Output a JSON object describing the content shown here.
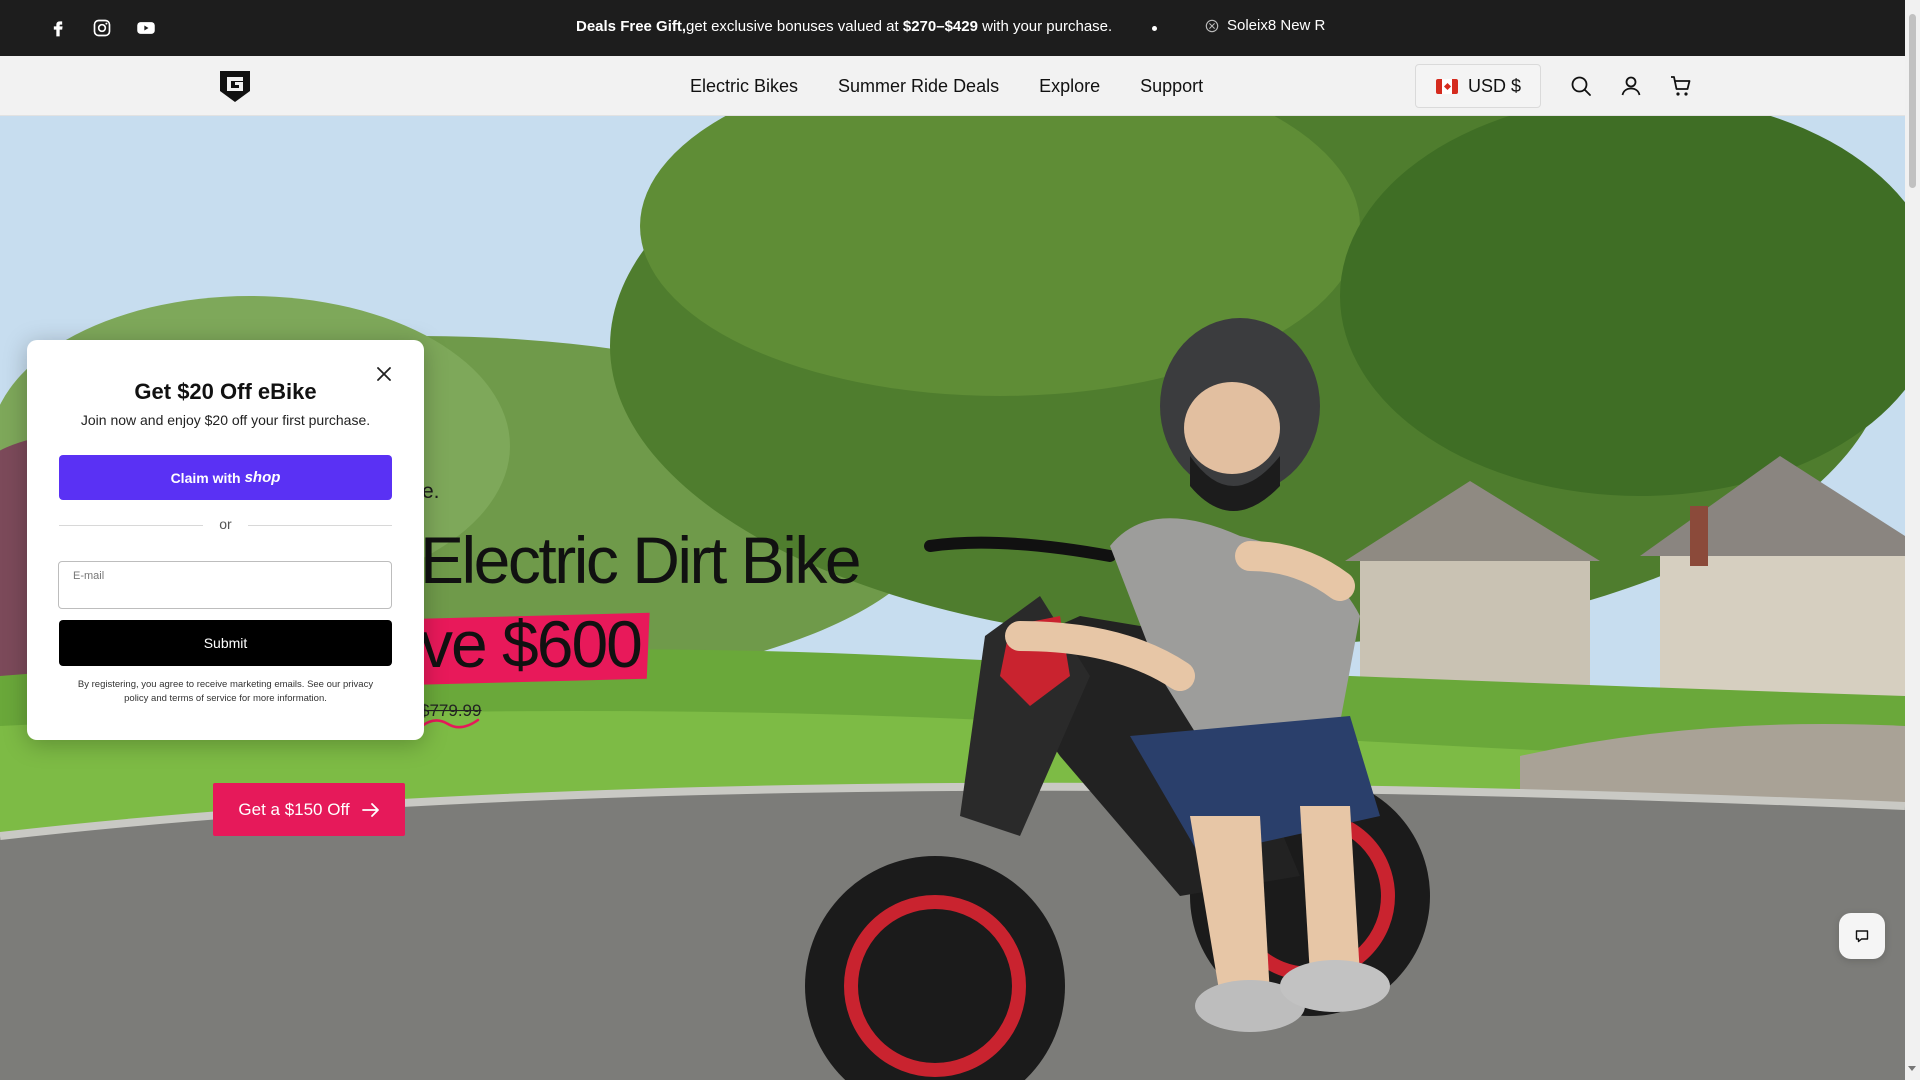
{
  "announcement": {
    "text_bold": "Deals Free Gift,",
    "text_mid": "get exclusive bonuses valued at ",
    "text_price": "$270–$429",
    "text_end": " with your purchase.",
    "ticker": "Soleix8 New R",
    "social_icons": [
      "facebook-icon",
      "instagram-icon",
      "youtube-icon"
    ]
  },
  "header": {
    "nav": [
      "Electric Bikes",
      "Summer Ride Deals",
      "Explore",
      "Support"
    ],
    "currency": "USD $",
    "icons": [
      "search-icon",
      "account-icon",
      "cart-icon"
    ]
  },
  "hero": {
    "eyebrow": "e.",
    "title": "Electric Dirt Bike",
    "save": "ve $600",
    "price_strike": "$779.99",
    "cta": "Get a $150 Off"
  },
  "popup": {
    "title": "Get $20 Off eBike",
    "subtitle": "Join now and enjoy $20 off your first purchase.",
    "claim_label": "Claim with",
    "claim_brand": "shop",
    "or": "or",
    "email_label": "E-mail",
    "email_value": "",
    "submit": "Submit",
    "legal": "By registering, you agree to receive marketing emails. See our privacy policy and terms of service for more information."
  },
  "colors": {
    "accent": "#e6195a",
    "shop_purple": "#5a31f4",
    "announce_bg": "#1d1d1d"
  }
}
